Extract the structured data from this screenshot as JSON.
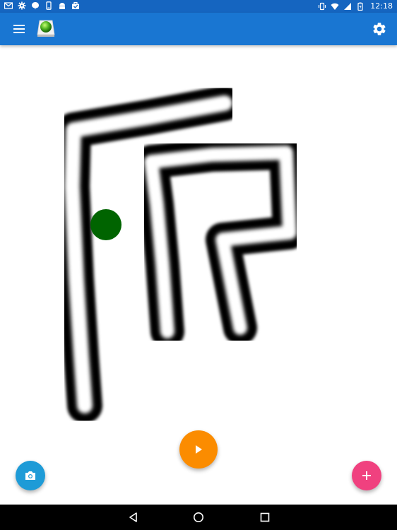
{
  "status_bar": {
    "time": "12:18",
    "left_icons": [
      "gmail-icon",
      "settings-gear-icon",
      "hangouts-icon",
      "phone-icon",
      "android-icon",
      "briefcase-icon"
    ],
    "right_icons": [
      "vibrate-icon",
      "wifi-icon",
      "signal-icon",
      "battery-icon"
    ]
  },
  "app_bar": {
    "menu_icon": "menu-icon",
    "logo_icon": "app-logo-green-ball-icon",
    "settings_icon": "settings-icon"
  },
  "canvas": {
    "track_description_color": "#000000",
    "track_inner_color": "#ffffff",
    "ball_color": "#006400"
  },
  "fabs": {
    "play": {
      "icon": "play-icon",
      "color": "#fb8c00"
    },
    "camera": {
      "icon": "camera-icon",
      "color": "#1e9bd7"
    },
    "add": {
      "icon": "plus-icon",
      "color": "#f0417f"
    }
  },
  "nav_bar": {
    "back_icon": "back-icon",
    "home_icon": "home-icon",
    "recent_icon": "recent-apps-icon"
  }
}
